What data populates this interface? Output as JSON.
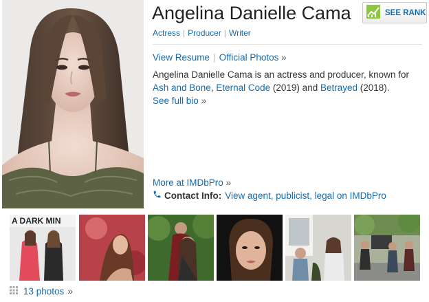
{
  "person": {
    "name": "Angelina Danielle Cama",
    "roles": [
      "Actress",
      "Producer",
      "Writer"
    ]
  },
  "rank_button": {
    "label": "SEE RANK",
    "icon": "rank-chart-icon"
  },
  "links": {
    "view_resume": "View Resume",
    "official_photos": "Official Photos",
    "raquo": "»"
  },
  "bio": {
    "intro": "Angelina Danielle Cama is an actress and producer, known for ",
    "title1": "Ash and Bone",
    "sep1": ", ",
    "title2": "Eternal Code",
    "year2": " (2019) and ",
    "title3": "Betrayed",
    "year3": " (2018).",
    "see_full_bio": "See full bio"
  },
  "imdbpro": {
    "more_at": "More at IMDbPro"
  },
  "contact": {
    "icon": "phone-icon",
    "label": "Contact Info:",
    "link": "View agent, publicist, legal on IMDbPro"
  },
  "photos": {
    "count_label": "13 photos",
    "thumb1_sign": "A DARK MIN"
  },
  "colors": {
    "link": "#136cb2",
    "rank_icon": "#8dc63f"
  }
}
